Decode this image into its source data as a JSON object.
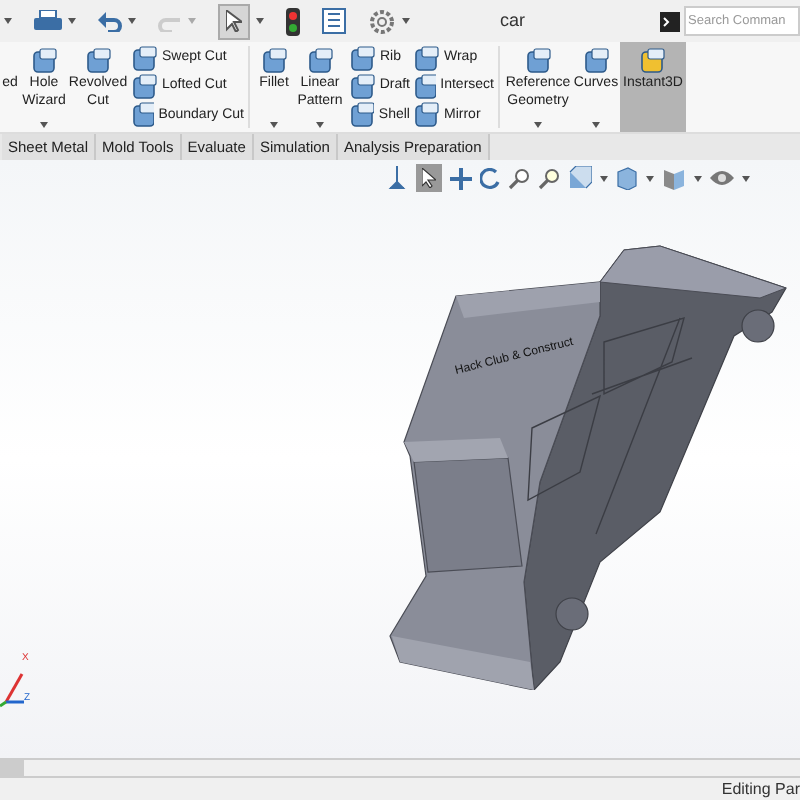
{
  "window": {
    "title": "car"
  },
  "search": {
    "placeholder": "Search Comman"
  },
  "ribbon": [
    {
      "kind": "large",
      "lines": [
        "ed"
      ],
      "dropdown": false,
      "selected": false
    },
    {
      "kind": "large",
      "lines": [
        "Hole",
        "Wizard"
      ],
      "dropdown": true,
      "selected": false
    },
    {
      "kind": "large",
      "lines": [
        "Revolved",
        "Cut"
      ],
      "dropdown": false,
      "selected": false
    },
    {
      "kind": "stack",
      "items": [
        "Swept Cut",
        "Lofted Cut",
        "Boundary Cut"
      ]
    },
    {
      "kind": "large",
      "lines": [
        "Fillet"
      ],
      "dropdown": true,
      "selected": false
    },
    {
      "kind": "large",
      "lines": [
        "Linear",
        "Pattern"
      ],
      "dropdown": true,
      "selected": false
    },
    {
      "kind": "stack",
      "items": [
        "Rib",
        "Draft",
        "Shell"
      ]
    },
    {
      "kind": "stack",
      "items": [
        "Wrap",
        "Intersect",
        "Mirror"
      ]
    },
    {
      "kind": "large",
      "lines": [
        "Reference",
        "Geometry"
      ],
      "dropdown": true,
      "selected": false
    },
    {
      "kind": "large",
      "lines": [
        "Curves"
      ],
      "dropdown": true,
      "selected": false
    },
    {
      "kind": "large",
      "lines": [
        "Instant3D"
      ],
      "dropdown": false,
      "selected": true
    }
  ],
  "tabs": [
    {
      "label": "Sheet Metal",
      "selected": false
    },
    {
      "label": "Mold Tools",
      "selected": false
    },
    {
      "label": "Evaluate",
      "selected": false
    },
    {
      "label": "Simulation",
      "selected": false
    },
    {
      "label": "Analysis Preparation",
      "selected": false
    }
  ],
  "model": {
    "label": "Hack Club & Construct"
  },
  "triad": {
    "labels": [
      "X",
      "Z"
    ]
  },
  "status_bar": {
    "text": "Editing Par"
  }
}
